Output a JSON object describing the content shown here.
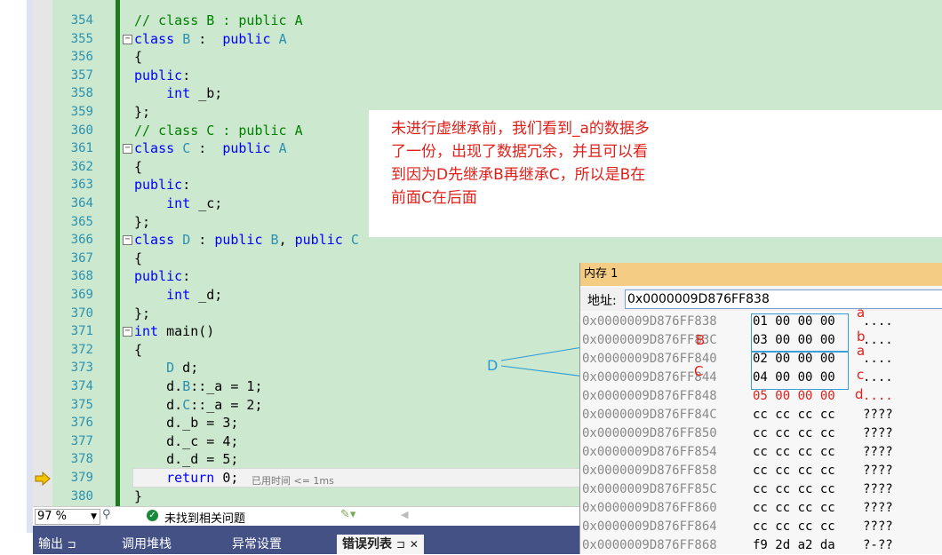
{
  "editor": {
    "lines": [
      {
        "n": "354",
        "code": "// class B : public A"
      },
      {
        "n": "355",
        "code": "class B :  public A"
      },
      {
        "n": "356",
        "code": "{"
      },
      {
        "n": "357",
        "code": "public:"
      },
      {
        "n": "358",
        "code": "    int _b;"
      },
      {
        "n": "359",
        "code": "};"
      },
      {
        "n": "360",
        "code": "// class C : public A"
      },
      {
        "n": "361",
        "code": "class C :  public A"
      },
      {
        "n": "362",
        "code": "{"
      },
      {
        "n": "363",
        "code": "public:"
      },
      {
        "n": "364",
        "code": "    int _c;"
      },
      {
        "n": "365",
        "code": "};"
      },
      {
        "n": "366",
        "code": "class D : public B, public C"
      },
      {
        "n": "367",
        "code": "{"
      },
      {
        "n": "368",
        "code": "public:"
      },
      {
        "n": "369",
        "code": "    int _d;"
      },
      {
        "n": "370",
        "code": "};"
      },
      {
        "n": "371",
        "code": "int main()"
      },
      {
        "n": "372",
        "code": "{"
      },
      {
        "n": "373",
        "code": "    D d;"
      },
      {
        "n": "374",
        "code": "    d.B::_a = 1;"
      },
      {
        "n": "375",
        "code": "    d.C::_a = 2;"
      },
      {
        "n": "376",
        "code": "    d._b = 3;"
      },
      {
        "n": "377",
        "code": "    d._c = 4;"
      },
      {
        "n": "378",
        "code": "    d._d = 5;"
      },
      {
        "n": "379",
        "code": "    return 0;"
      },
      {
        "n": "380",
        "code": "}"
      }
    ],
    "timing": "已用时间 <= 1ms"
  },
  "annotation": {
    "text": "未进行虚继承前，我们看到_a的数据多了一份，出现了数据冗余，并且可以看到因为D先继承B再继承C，所以是B在前面C在后面",
    "d_label": "D",
    "marks": {
      "a1": "a",
      "b": "b",
      "a2": "a",
      "c": "c",
      "d": "d",
      "B": "B",
      "C": "C"
    }
  },
  "status": {
    "zoom": "97 %",
    "no_issues": "未找到相关问题"
  },
  "bottom_tabs": [
    "输出",
    "调用堆栈",
    "异常设置",
    "错误列表"
  ],
  "bottom_tab_pin": "⊐",
  "bottom_tab_close": "✕",
  "memory": {
    "title": "内存 1",
    "addr_label": "地址:",
    "addr_value": "0x0000009D876FF838",
    "rows": [
      {
        "addr": "0x0000009D876FF838",
        "bytes": "01 00 00 00",
        "ascii": "...."
      },
      {
        "addr": "0x0000009D876FF83C",
        "bytes": "03 00 00 00",
        "ascii": "...."
      },
      {
        "addr": "0x0000009D876FF840",
        "bytes": "02 00 00 00",
        "ascii": "...."
      },
      {
        "addr": "0x0000009D876FF844",
        "bytes": "04 00 00 00",
        "ascii": "...."
      },
      {
        "addr": "0x0000009D876FF848",
        "bytes": "05 00 00 00",
        "ascii": "...."
      },
      {
        "addr": "0x0000009D876FF84C",
        "bytes": "cc cc cc cc",
        "ascii": "????"
      },
      {
        "addr": "0x0000009D876FF850",
        "bytes": "cc cc cc cc",
        "ascii": "????"
      },
      {
        "addr": "0x0000009D876FF854",
        "bytes": "cc cc cc cc",
        "ascii": "????"
      },
      {
        "addr": "0x0000009D876FF858",
        "bytes": "cc cc cc cc",
        "ascii": "????"
      },
      {
        "addr": "0x0000009D876FF85C",
        "bytes": "cc cc cc cc",
        "ascii": "????"
      },
      {
        "addr": "0x0000009D876FF860",
        "bytes": "cc cc cc cc",
        "ascii": "????"
      },
      {
        "addr": "0x0000009D876FF864",
        "bytes": "cc cc cc cc",
        "ascii": "????"
      },
      {
        "addr": "0x0000009D876FF868",
        "bytes": "f9 2d a2 da",
        "ascii": "?-??"
      }
    ]
  },
  "colors": {
    "annotation": "#e0201a",
    "link": "#2a9bd6",
    "memory_title": "#f5cc84"
  }
}
